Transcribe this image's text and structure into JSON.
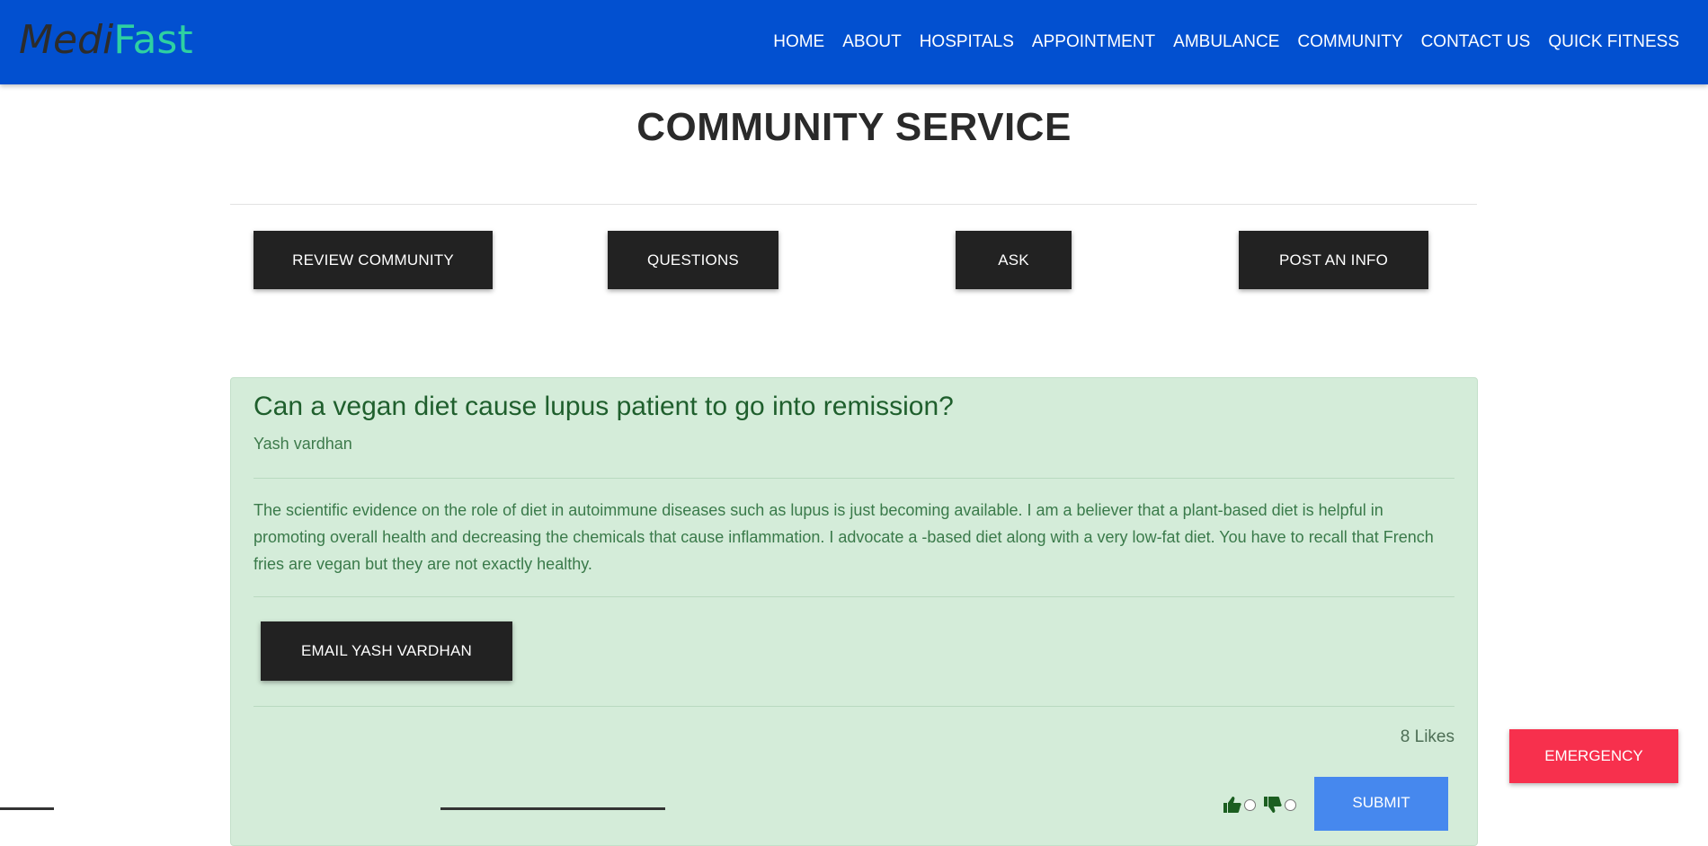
{
  "brand": {
    "part1": "Medi",
    "part2": "Fast"
  },
  "nav": {
    "items": [
      "HOME",
      "ABOUT",
      "HOSPITALS",
      "APPOINTMENT",
      "AMBULANCE",
      "COMMUNITY",
      "CONTACT US",
      "QUICK FITNESS"
    ]
  },
  "page": {
    "title": "COMMUNITY SERVICE"
  },
  "actions": {
    "review_community": "REVIEW COMMUNITY",
    "questions": "QUESTIONS",
    "ask": "ASK",
    "post_info": "POST AN INFO"
  },
  "post": {
    "title": "Can a vegan diet cause lupus patient to go into remission?",
    "author": "Yash vardhan",
    "body": "The scientific evidence on the role of diet in autoimmune diseases such as lupus is just becoming available. I am a believer that a plant-based diet is helpful in promoting overall health and decreasing the chemicals that cause inflammation. I advocate a -based diet along with a very low-fat diet. You have to recall that French fries are vegan but they are not exactly healthy.",
    "email_button": "EMAIL YASH VARDHAN",
    "likes": "8 Likes",
    "submit": "SUBMIT"
  },
  "emergency": "EMERGENCY",
  "colors": {
    "navbar": "#0250d0",
    "brand_accent": "#2ed0a2",
    "card_bg": "#d4ecd9",
    "submit": "#4688ee",
    "emergency": "#f7304d"
  },
  "icons": [
    "thumbs-up-icon",
    "thumbs-down-icon"
  ]
}
